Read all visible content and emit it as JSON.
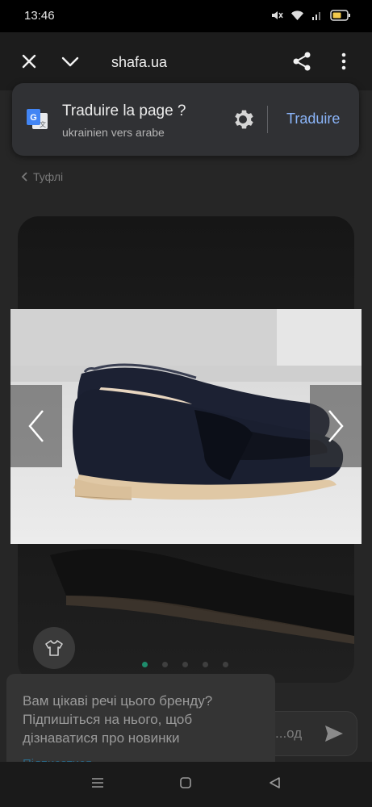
{
  "status_bar": {
    "time": "13:46"
  },
  "toolbar": {
    "url": "shafa.ua"
  },
  "translate_bar": {
    "title": "Traduire la page ?",
    "subtitle": "ukrainien vers arabe",
    "action": "Traduire"
  },
  "breadcrumb": {
    "label": "Туфлі"
  },
  "gallery": {
    "slides": 5,
    "active_index": 0
  },
  "message_field": {
    "placeholder": "...од"
  },
  "popup": {
    "text": "Вам цікаві речі цього бренду? Підпишіться на нього, щоб дізнаватися про новинки",
    "link": "Підписатися"
  },
  "colors": {
    "accent": "#8ab4f8",
    "active_dot": "#1e8c6c",
    "card": "#303134"
  }
}
